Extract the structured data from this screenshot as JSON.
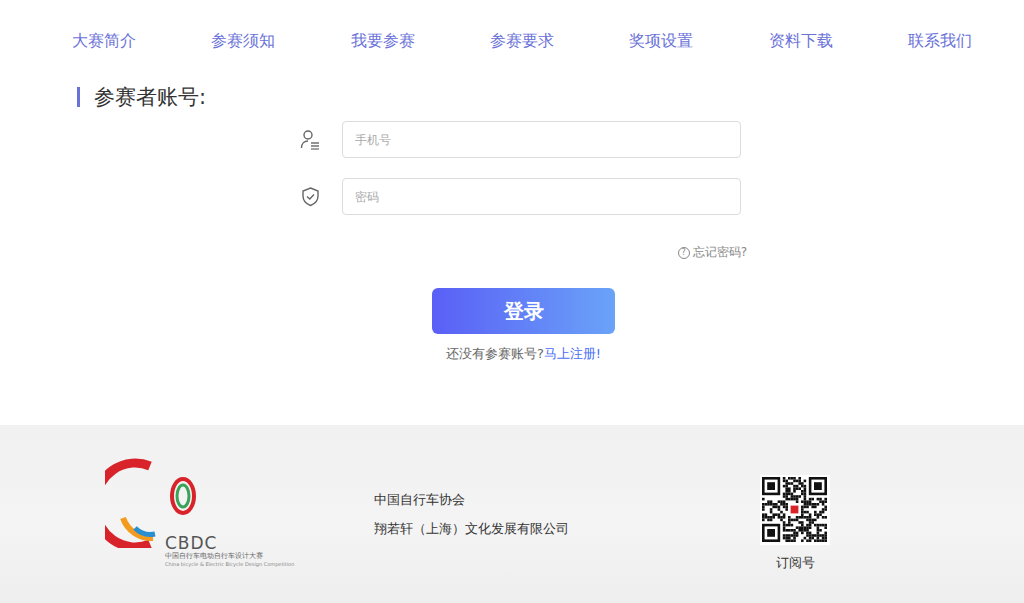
{
  "nav": [
    "大赛简介",
    "参赛须知",
    "我要参赛",
    "参赛要求",
    "奖项设置",
    "资料下载",
    "联系我们"
  ],
  "section_title": "参赛者账号:",
  "form": {
    "phone_placeholder": "手机号",
    "password_placeholder": "密码",
    "forgot_icon": "?",
    "forgot": "忘记密码?",
    "login_button": "登录",
    "register_prompt": "还没有参赛账号?",
    "register_link": "马上注册!"
  },
  "footer": {
    "logo": {
      "text": "CBDC",
      "subtitle_cn": "中国自行车电动自行车设计大赛",
      "subtitle_en": "China bicycle & Electric Bicycle Design Competition"
    },
    "organizers": [
      "中国自行车协会",
      "翔若轩（上海）文化发展有限公司"
    ],
    "qr_caption": "订阅号"
  }
}
